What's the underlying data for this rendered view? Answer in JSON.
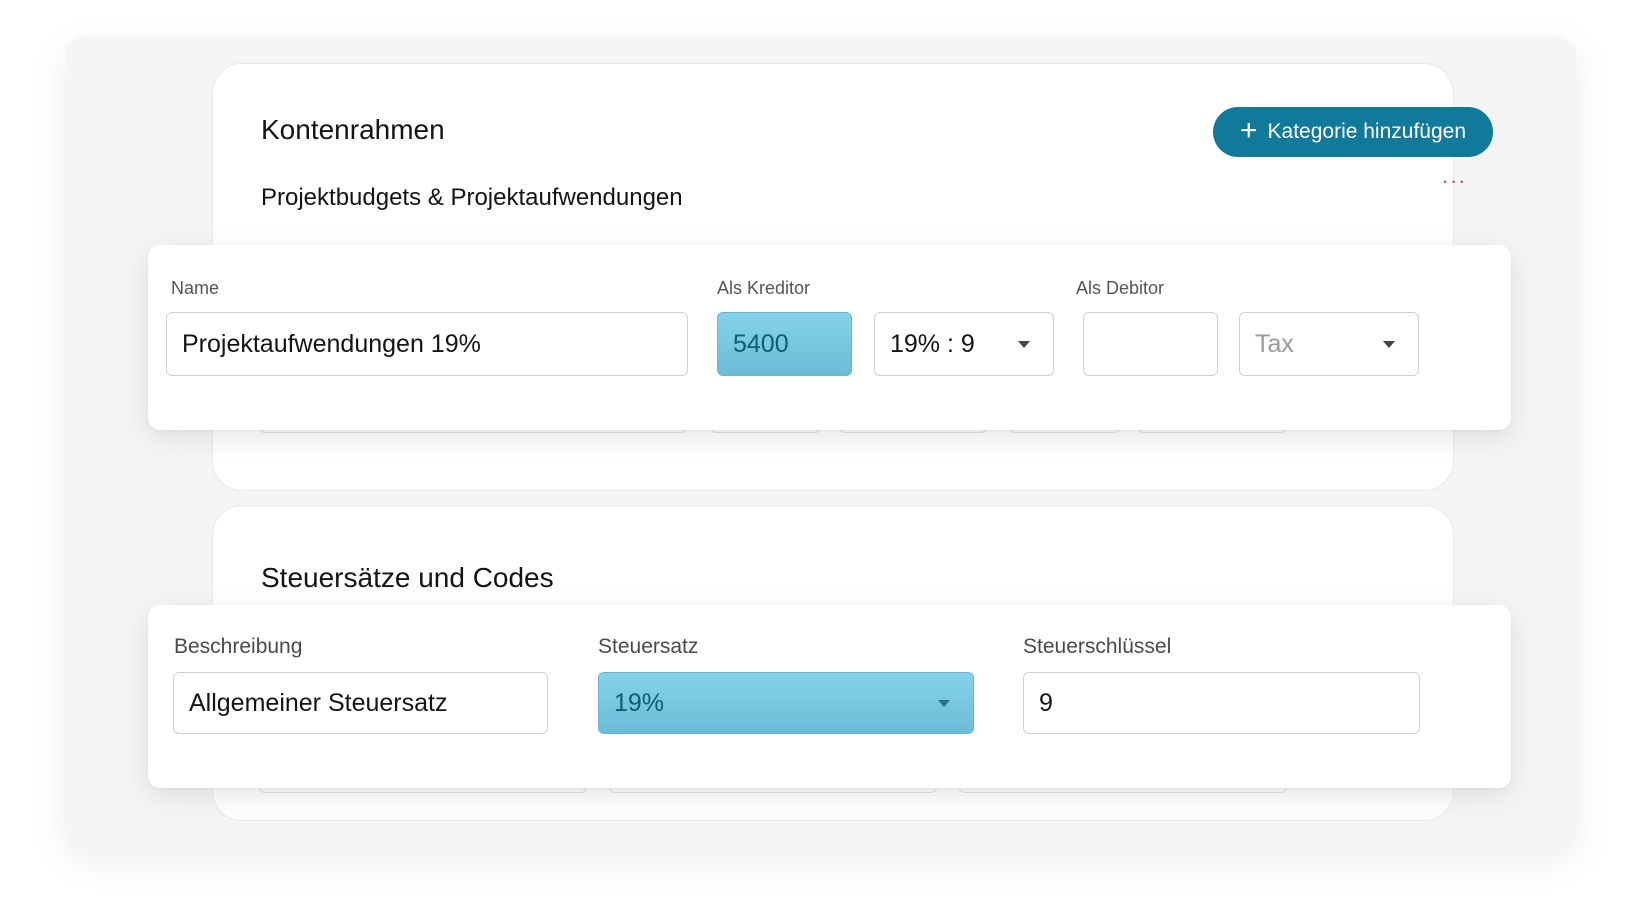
{
  "accounts": {
    "title": "Kontenrahmen",
    "add_button_label": "Kategorie hinzufügen",
    "more_label": "···",
    "group_title": "Projektbudgets & Projektaufwendungen",
    "row": {
      "name_label": "Name",
      "creditor_label": "Als Kreditor",
      "debtor_label": "Als Debitor",
      "name_value": "Projektaufwendungen 19%",
      "creditor_account": "5400",
      "creditor_tax": "19% : 9",
      "debtor_account": "",
      "debtor_tax_placeholder": "Tax"
    }
  },
  "taxes": {
    "title": "Steuersätze und Codes",
    "row": {
      "description_label": "Beschreibung",
      "rate_label": "Steuersatz",
      "key_label": "Steuerschlüssel",
      "description_value": "Allgemeiner Steuersatz",
      "rate_value": "19%",
      "key_value": "9"
    }
  },
  "colors": {
    "accent": "#11799a",
    "highlight": "#84d3ea",
    "more_dots": "#d24a5a"
  }
}
